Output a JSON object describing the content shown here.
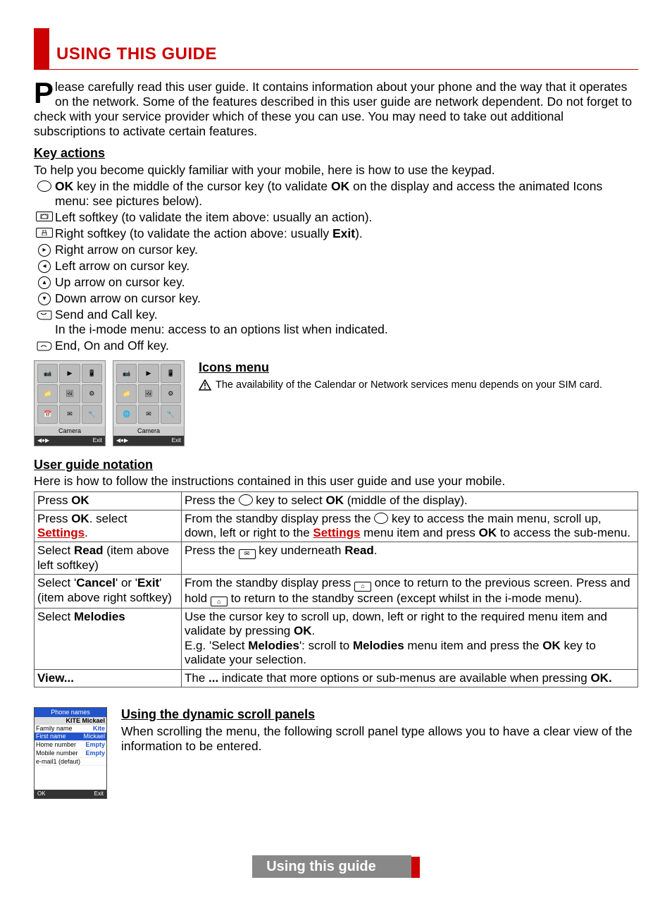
{
  "title": "USING THIS GUIDE",
  "intro_first_letter": "P",
  "intro_rest": "lease carefully read this user guide. It contains information about your phone and the way that it operates on the network. Some of the features described in this user guide are network dependent. Do not forget to check with your service provider which of these you can use. You may need to take out additional subscriptions to activate certain features.",
  "key_actions_head": "Key actions",
  "key_actions_intro": "To help you become quickly familiar with your mobile, here is how to use the keypad.",
  "keys": {
    "ok_pre": " key in the middle of the cursor key (to validate ",
    "ok_bold1": "OK",
    "ok_bold2": "OK",
    "ok_post": " on the display and access the animated Icons menu: see pictures below).",
    "left_soft": "Left softkey (to validate the item above: usually an action).",
    "right_soft_pre": "Right softkey (to validate the action above: usually ",
    "right_soft_bold": "Exit",
    "right_soft_post": ").",
    "right_arrow": "Right arrow on cursor key.",
    "left_arrow": "Left arrow on cursor key.",
    "up_arrow": "Up arrow on cursor key.",
    "down_arrow": "Down arrow on cursor key.",
    "send_call": "Send and Call key.",
    "send_call_2": "In the i-mode menu: access to an options list when indicated.",
    "end_key": "End, On and Off key."
  },
  "icons_menu_head": "Icons menu",
  "icons_menu_note": "The availability of the Calendar or Network services menu depends on your SIM card.",
  "phone_screen_label": "Camera",
  "phone_screen_exit": "Exit",
  "notation_head": "User guide notation",
  "notation_intro": "Here is how to follow the instructions contained in this user guide and use your mobile.",
  "table": {
    "r1c1_pre": "Press ",
    "r1c1_b": "OK",
    "r1c2_pre": "Press the ",
    "r1c2_mid": " key to select ",
    "r1c2_b": "OK",
    "r1c2_post": " (middle of the display).",
    "r2c1_pre": "Press ",
    "r2c1_b": "OK",
    "r2c1_mid": ". select ",
    "r2c1_link": "Settings",
    "r2c1_post": ".",
    "r2c2_pre": "From the standby display press the ",
    "r2c2_mid": " key to access the main menu, scroll up, down, left or right to the ",
    "r2c2_link": "Settings",
    "r2c2_mid2": " menu item and press ",
    "r2c2_b": "OK",
    "r2c2_post": " to access the sub-menu.",
    "r3c1_pre": "Select ",
    "r3c1_b": "Read",
    "r3c1_post": " (item above left softkey)",
    "r3c2_pre": "Press the ",
    "r3c2_mid": " key underneath ",
    "r3c2_b": "Read",
    "r3c2_post": ".",
    "r4c1_pre": "Select '",
    "r4c1_b1": "Cancel",
    "r4c1_mid": "' or '",
    "r4c1_b2": "Exit",
    "r4c1_post": "' (item above right softkey)",
    "r4c2_pre": "From the standby display press ",
    "r4c2_mid": " once to return to the previous screen. Press and hold ",
    "r4c2_post": " to return to the standby screen (except whilst in the i-mode menu).",
    "r5c1_pre": "Select ",
    "r5c1_b": "Melodies",
    "r5c2_pre": "Use the cursor key to scroll up, down, left or right to the required menu item and validate by pressing ",
    "r5c2_b1": "OK",
    "r5c2_mid": ".\nE.g. 'Select ",
    "r5c2_b2": "Melodies",
    "r5c2_mid2": "': scroll to ",
    "r5c2_b3": "Melodies",
    "r5c2_mid3": " menu item and press the ",
    "r5c2_b4": "OK",
    "r5c2_post": " key to validate your selection.",
    "r6c1": "View...",
    "r6c2_pre": "The ",
    "r6c2_b1": "...",
    "r6c2_mid": " indicate that more options or  sub-menus are available when pressing ",
    "r6c2_b2": "OK."
  },
  "scroll_head": "Using the dynamic scroll panels",
  "scroll_text": "When scrolling the menu, the following scroll panel type allows you to have a clear view of the information to be entered.",
  "scroll_screen": {
    "header": "Phone names",
    "sub": "KITE Mickael",
    "rows": [
      {
        "l": "Family name",
        "v": "Kite"
      },
      {
        "l": "First name",
        "v": "Mickael"
      },
      {
        "l": "Home number",
        "v": "Empty"
      },
      {
        "l": "Mobile number",
        "v": "Empty"
      },
      {
        "l": "e-mail1 (defaut)",
        "v": ""
      }
    ],
    "ok": "OK",
    "exit": "Exit"
  },
  "footer": "Using this guide"
}
